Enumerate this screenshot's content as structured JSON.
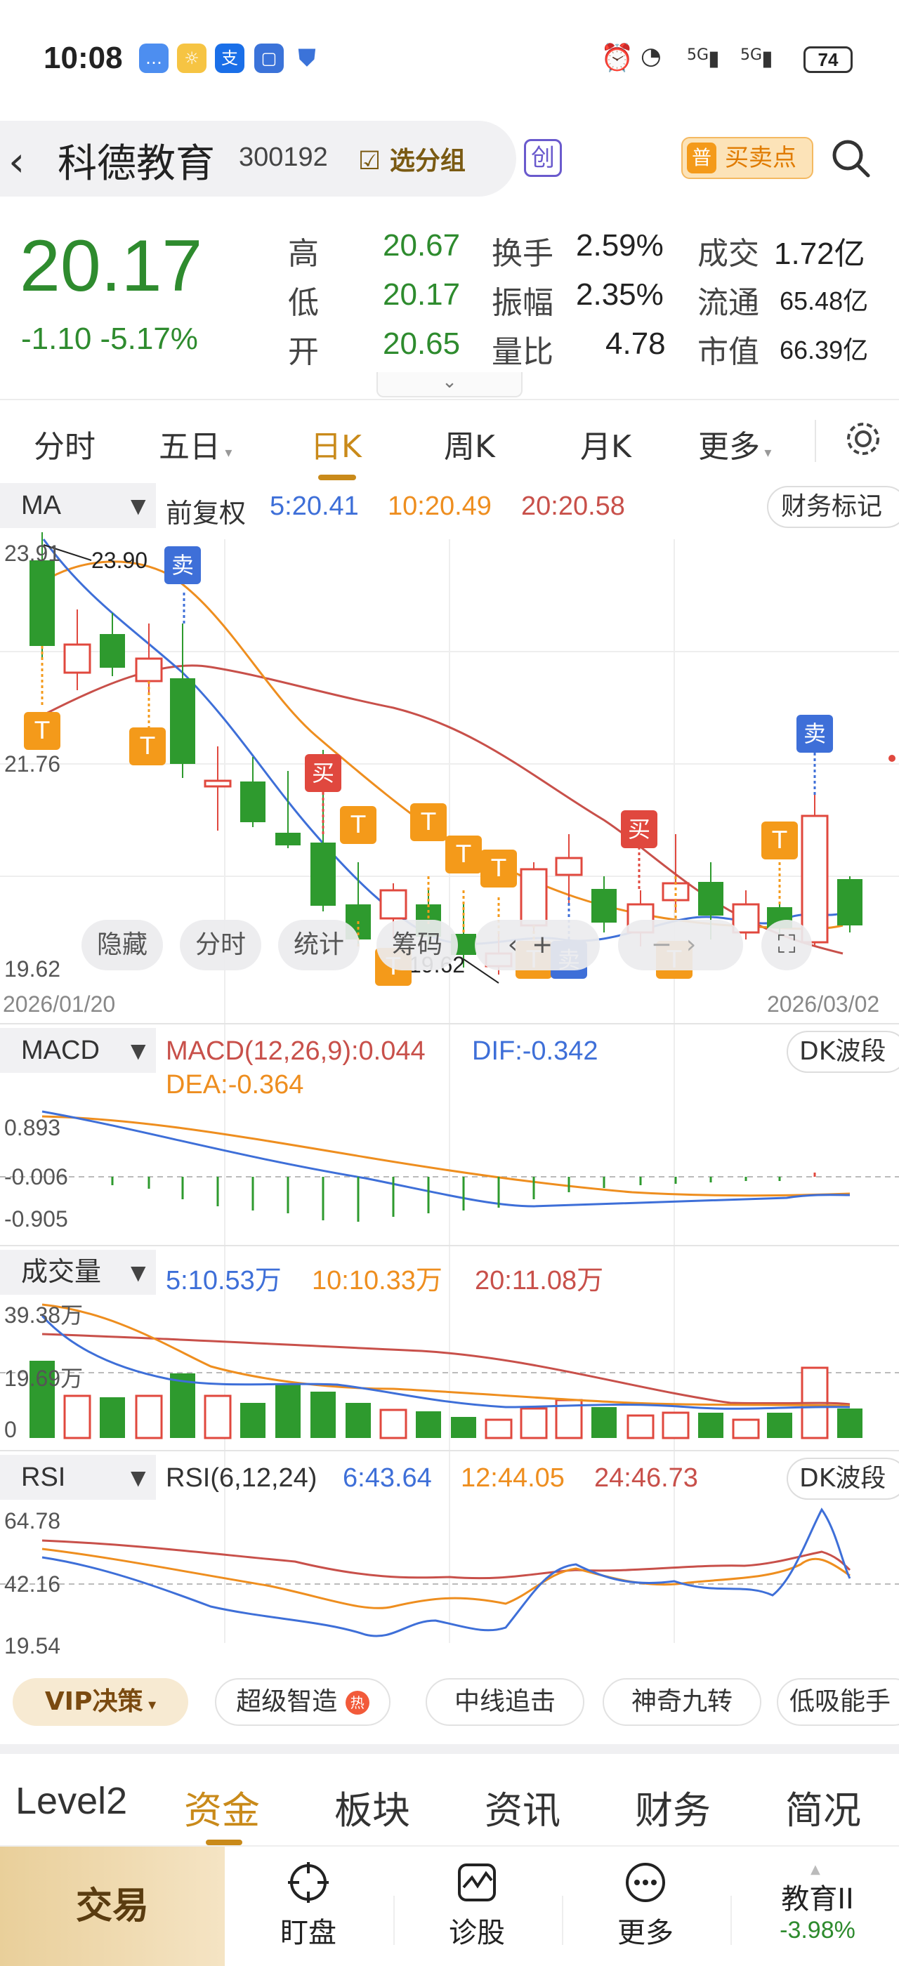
{
  "status_bar": {
    "time": "10:08",
    "battery": "74",
    "network": "5G"
  },
  "header": {
    "stock_name": "科德教育",
    "stock_code": "300192",
    "favorite_group": "选分组",
    "board_badge": "创",
    "buy_sell_badge": "普",
    "buy_sell_label": "买卖点"
  },
  "quote": {
    "price": "20.17",
    "change": "-1.10 -5.17%",
    "high_label": "高",
    "high": "20.67",
    "low_label": "低",
    "low": "20.17",
    "open_label": "开",
    "open": "20.65",
    "turnover_label": "换手",
    "turnover": "2.59%",
    "amplitude_label": "振幅",
    "amplitude": "2.35%",
    "vol_ratio_label": "量比",
    "vol_ratio": "4.78",
    "amount_label": "成交",
    "amount": "1.72亿",
    "float_label": "流通",
    "float_cap": "65.48亿",
    "mcap_label": "市值",
    "mcap": "66.39亿"
  },
  "period_tabs": [
    "分时",
    "五日",
    "日K",
    "周K",
    "月K",
    "更多"
  ],
  "kline": {
    "selector": "MA",
    "adjust": "前复权",
    "ma5": "5:20.41",
    "ma10": "10:20.49",
    "ma20": "20:20.58",
    "finance_mark": "财务标记",
    "axis_top": "23.91",
    "axis_mid": "21.76",
    "axis_bottom": "19.62",
    "max_marker": "23.90",
    "min_marker": "19.62",
    "date_start": "2026/01/20",
    "date_end": "2026/03/02",
    "buttons": [
      "隐藏",
      "分时",
      "统计",
      "筹码"
    ],
    "signals": {
      "t": "T",
      "buy": "买",
      "sell": "卖"
    },
    "colors": {
      "up": "#e0483e",
      "down": "#2e9a2e",
      "ma5": "#3e6fd8",
      "ma10": "#ee8e1f",
      "ma20": "#c8504a"
    }
  },
  "macd": {
    "selector": "MACD",
    "label": "MACD(12,26,9):0.044",
    "dif": "DIF:-0.342",
    "dea": "DEA:-0.364",
    "wave": "DK波段",
    "axis_top": "0.893",
    "axis_mid": "-0.006",
    "axis_bottom": "-0.905"
  },
  "volume": {
    "selector": "成交量",
    "ma5": "5:10.53万",
    "ma10": "10:10.33万",
    "ma20": "20:11.08万",
    "axis_top": "39.38万",
    "axis_mid": "19.69万",
    "axis_bottom": "0"
  },
  "rsi": {
    "selector": "RSI",
    "label": "RSI(6,12,24)",
    "rsi6": "6:43.64",
    "rsi12": "12:44.05",
    "rsi24": "24:46.73",
    "wave": "DK波段",
    "axis_top": "64.78",
    "axis_mid": "42.16",
    "axis_bottom": "19.54"
  },
  "strategies": {
    "vip": "VIP决策",
    "items": [
      "超级智造",
      "中线追击",
      "神奇九转",
      "低吸能手"
    ]
  },
  "sub_tabs": [
    "Level2",
    "资金",
    "板块",
    "资讯",
    "财务",
    "简况"
  ],
  "bottom_nav": {
    "trade": "交易",
    "watch": "盯盘",
    "diagnose": "诊股",
    "more": "更多",
    "sector_name": "教育II",
    "sector_change": "-3.98%"
  }
}
